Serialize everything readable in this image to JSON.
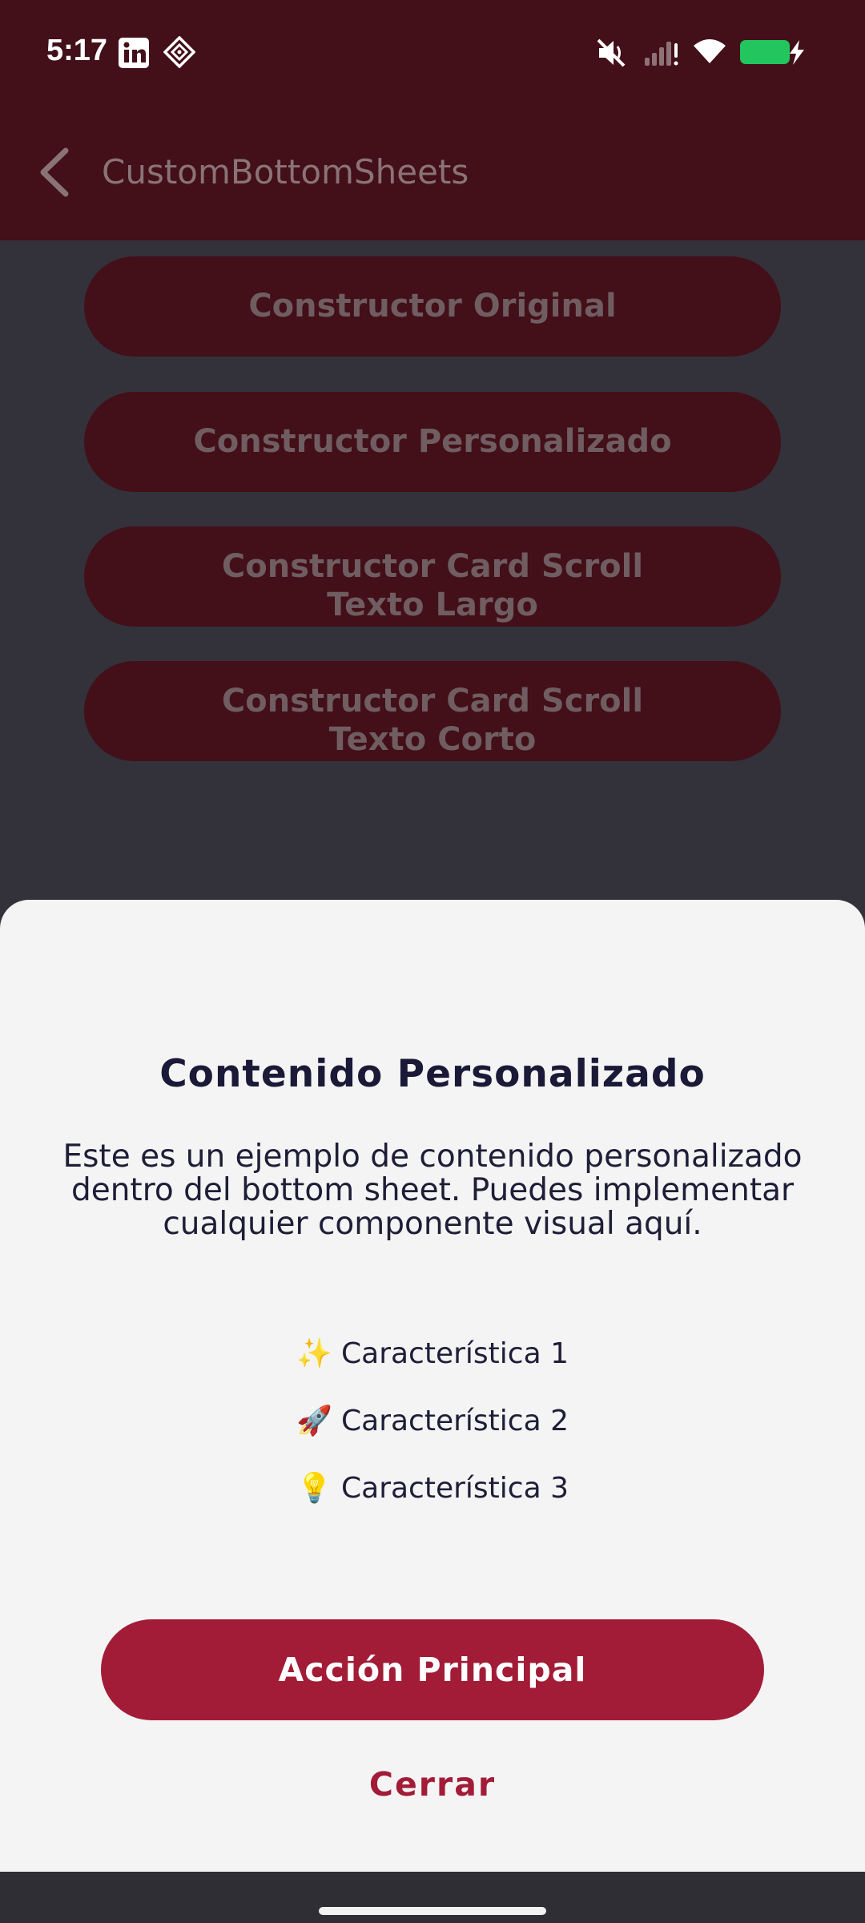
{
  "status_bar": {
    "time": "5:17",
    "left_icons": [
      "linkedin-icon",
      "app-notification-icon"
    ],
    "right_icons": [
      "mute-icon",
      "cellular-signal-icon",
      "wifi-icon",
      "battery-charging-icon"
    ],
    "battery_color": "#22c55e"
  },
  "app_bar": {
    "back_icon": "chevron-left-icon",
    "title": "CustomBottomSheets"
  },
  "background_buttons": [
    {
      "label": "Constructor Original"
    },
    {
      "label": "Constructor Personalizado"
    },
    {
      "label": "Constructor Card Scroll Texto Largo"
    },
    {
      "label": "Constructor Card Scroll Texto Corto"
    }
  ],
  "sheet": {
    "title": "Contenido Personalizado",
    "description": "Este es un ejemplo de contenido personalizado dentro del bottom sheet. Puedes implementar cualquier componente visual aquí.",
    "features": [
      {
        "emoji": "✨",
        "label": "Característica 1"
      },
      {
        "emoji": "🚀",
        "label": "Característica 2"
      },
      {
        "emoji": "💡",
        "label": "Característica 3"
      }
    ],
    "primary_action": "Acción Principal",
    "close_action": "Cerrar"
  },
  "colors": {
    "brand_primary": "#a21c37",
    "app_bar": "#430f18",
    "scrim_background": "#33323a",
    "sheet_background": "#f4f4f4",
    "title_text": "#1a1937"
  }
}
